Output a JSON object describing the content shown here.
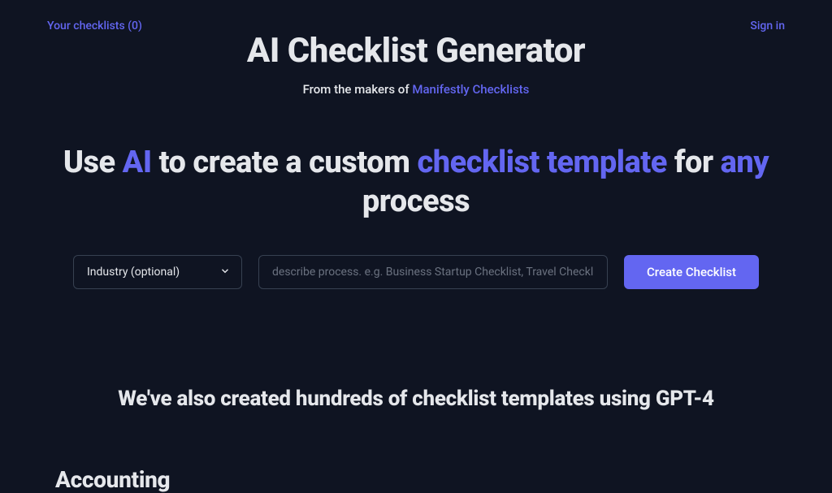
{
  "nav": {
    "your_checklists": "Your checklists (0)",
    "sign_in": "Sign in"
  },
  "header": {
    "title": "AI Checklist Generator",
    "subtitle_prefix": "From the makers of ",
    "subtitle_link": "Manifestly Checklists"
  },
  "hero": {
    "part1": "Use ",
    "accent1": "AI",
    "part2": " to create a custom ",
    "accent2": "checklist template",
    "part3": " for ",
    "accent3": "any",
    "part4": " process"
  },
  "form": {
    "industry_label": "Industry (optional)",
    "process_placeholder": "describe process. e.g. Business Startup Checklist, Travel Checklist, etc.",
    "button_label": "Create Checklist"
  },
  "templates_heading": "We've also created hundreds of checklist templates using GPT-4",
  "category": {
    "title": "Accounting"
  }
}
